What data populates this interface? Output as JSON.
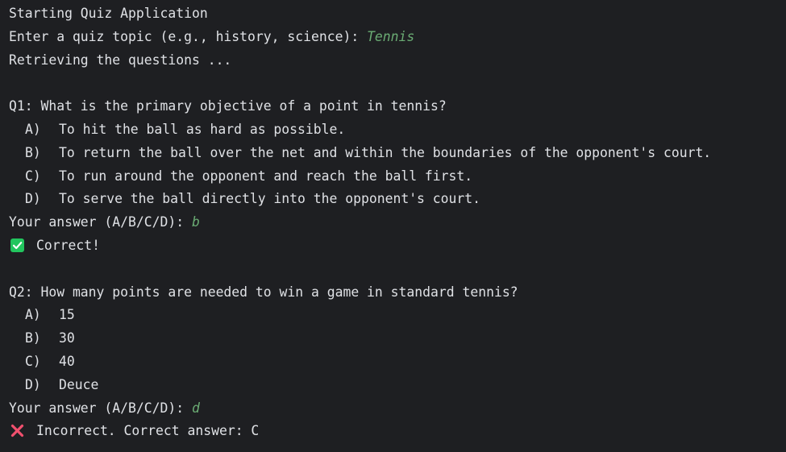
{
  "app": {
    "start_message": "Starting Quiz Application",
    "topic_prompt": "Enter a quiz topic (e.g., history, science): ",
    "topic_input": "Tennis",
    "retrieving_message": "Retrieving the questions ..."
  },
  "questions": [
    {
      "text": "Q1: What is the primary objective of a point in tennis?",
      "options": [
        {
          "letter": "A)",
          "text": "To hit the ball as hard as possible."
        },
        {
          "letter": "B)",
          "text": "To return the ball over the net and within the boundaries of the opponent's court."
        },
        {
          "letter": "C)",
          "text": "To run around the opponent and reach the ball first."
        },
        {
          "letter": "D)",
          "text": "To serve the ball directly into the opponent's court."
        }
      ],
      "answer_prompt": "Your answer (A/B/C/D): ",
      "answer_input": "b",
      "result_icon": "check-mark-icon",
      "result_text": "Correct!"
    },
    {
      "text": "Q2: How many points are needed to win a game in standard tennis?",
      "options": [
        {
          "letter": "A)",
          "text": "15"
        },
        {
          "letter": "B)",
          "text": "30"
        },
        {
          "letter": "C)",
          "text": "40"
        },
        {
          "letter": "D)",
          "text": "Deuce"
        }
      ],
      "answer_prompt": "Your answer (A/B/C/D): ",
      "answer_input": "d",
      "result_icon": "cross-mark-icon",
      "result_text": "Incorrect. Correct answer: C"
    }
  ],
  "colors": {
    "background": "#1e1f22",
    "text": "#dfe1e5",
    "user_input": "#6aab73",
    "correct": "#22c55e",
    "incorrect": "#f0506e"
  }
}
